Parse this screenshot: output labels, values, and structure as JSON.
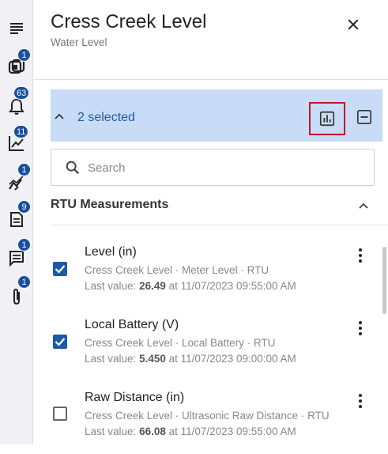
{
  "header": {
    "title": "Cress Creek Level",
    "subtitle": "Water Level"
  },
  "rail": {
    "items": [
      {
        "icon": "menu-icon",
        "badge": ""
      },
      {
        "icon": "devices-icon",
        "badge": "1"
      },
      {
        "icon": "bell-icon",
        "badge": "63"
      },
      {
        "icon": "trend-chart-icon",
        "badge": "11"
      },
      {
        "icon": "anomaly-chart-icon",
        "badge": "1"
      },
      {
        "icon": "notes-icon",
        "badge": "9"
      },
      {
        "icon": "comment-icon",
        "badge": "1"
      },
      {
        "icon": "attachment-icon",
        "badge": "1"
      }
    ]
  },
  "selection": {
    "label": "2 selected"
  },
  "search": {
    "placeholder": "Search"
  },
  "section": {
    "title": "RTU Measurements"
  },
  "measurements": [
    {
      "name": "Level (in)",
      "meta": "Cress Creek Level · Meter Level · RTU",
      "last_prefix": "Last value:",
      "last_value": "26.49",
      "last_suffix": "at 11/07/2023 09:55:00 AM",
      "checked": true
    },
    {
      "name": "Local Battery (V)",
      "meta": "Cress Creek Level · Local Battery · RTU",
      "last_prefix": "Last value:",
      "last_value": "5.450",
      "last_suffix": "at 11/07/2023 09:00:00 AM",
      "checked": true
    },
    {
      "name": "Raw Distance (in)",
      "meta": "Cress Creek Level · Ultrasonic Raw Distance · RTU",
      "last_prefix": "Last value:",
      "last_value": "66.08",
      "last_suffix": "at 11/07/2023 09:55:00 AM",
      "checked": false
    }
  ],
  "colors": {
    "accent": "#1a5aa8",
    "selection_bg": "#c8dcf8",
    "badge": "#1a4f9c",
    "highlight_border": "#c0172b"
  }
}
